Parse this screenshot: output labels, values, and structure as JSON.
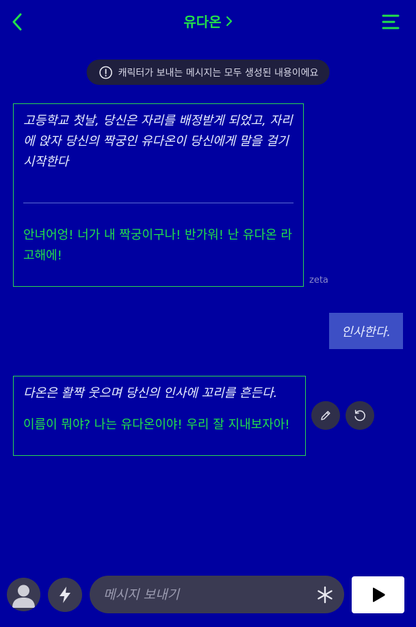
{
  "header": {
    "title": "유다온",
    "back_icon": "chevron-left-icon",
    "title_chevron_icon": "chevron-right-icon",
    "menu_icon": "hamburger-menu-icon"
  },
  "notice": {
    "icon": "info-icon",
    "text": "캐릭터가 보내는 메시지는 모두 생성된 내용이에요"
  },
  "messages": [
    {
      "sender": "character",
      "narration": "고등학교 첫날, 당신은 자리를 배정받게 되었고, 자리에 앉자 당신의 짝궁인 유다온이 당신에게 말을 걸기 시작한다",
      "speech": "안녀어엉! 너가 내 짝궁이구나! 반가워! 난 유다온 라고해에!",
      "tag": "zeta"
    },
    {
      "sender": "user",
      "narration": "인사한다."
    },
    {
      "sender": "character",
      "narration": "다온은 활짝 웃으며 당신의 인사에 꼬리를 흔든다.",
      "speech": "이름이 뭐야? 나는 유다온이야! 우리 잘 지내보자아!",
      "actions": [
        "edit-icon",
        "regenerate-icon"
      ]
    }
  ],
  "composer": {
    "placeholder": "메시지 보내기",
    "avatar_icon": "user-avatar-icon",
    "bolt_icon": "lightning-bolt-icon",
    "asterisk_icon": "asterisk-icon",
    "send_icon": "play-send-icon"
  },
  "colors": {
    "background": "#0000a0",
    "accent_green": "#22e04a",
    "user_bubble": "#3d4fc5",
    "dark_control": "#3a3a52"
  }
}
